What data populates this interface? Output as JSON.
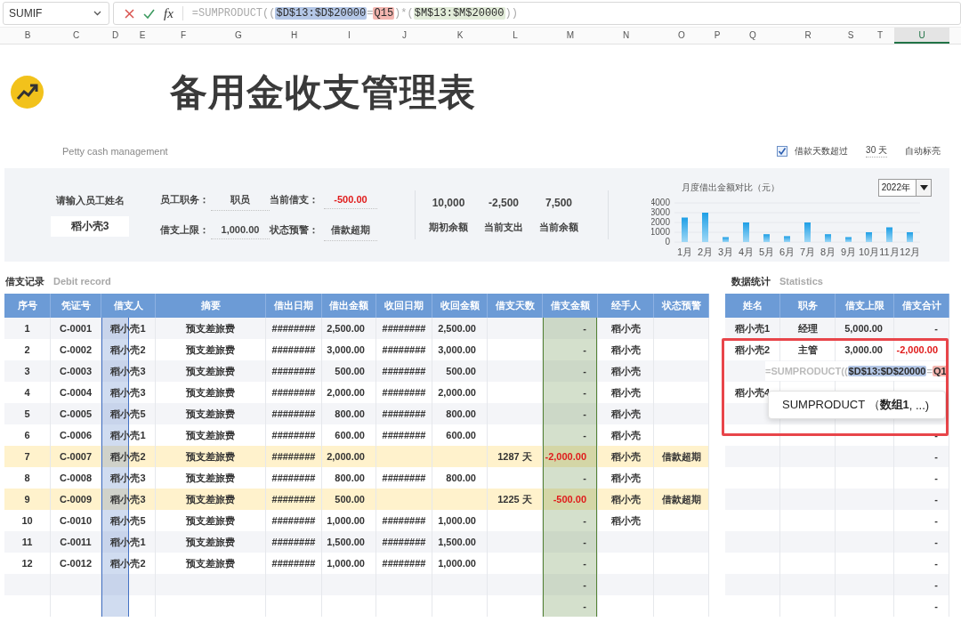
{
  "formula_bar": {
    "name_box": "SUMIF",
    "function_label": "fx",
    "formula": [
      {
        "text": "=SUMPRODUCT(("
      },
      {
        "text": "$D$13:$D$20000",
        "color": "#b4c7e7"
      },
      {
        "text": "="
      },
      {
        "text": "Q15",
        "color": "#f4b6b0"
      },
      {
        "text": ")*("
      },
      {
        "text": "$M$13:$M$20000",
        "color": "#e2ecd9"
      },
      {
        "text": "))"
      }
    ]
  },
  "column_headers": [
    {
      "label": "B",
      "selected": false
    },
    {
      "label": "C",
      "selected": false
    },
    {
      "label": "D",
      "selected": false
    },
    {
      "label": "E",
      "selected": false
    },
    {
      "label": "F",
      "selected": false
    },
    {
      "label": "G",
      "selected": false
    },
    {
      "label": "H",
      "selected": false
    },
    {
      "label": "I",
      "selected": false
    },
    {
      "label": "J",
      "selected": false
    },
    {
      "label": "K",
      "selected": false
    },
    {
      "label": "L",
      "selected": false
    },
    {
      "label": "M",
      "selected": false
    },
    {
      "label": "N",
      "selected": false
    },
    {
      "label": "O",
      "selected": false
    },
    {
      "label": "P",
      "selected": false
    },
    {
      "label": "Q",
      "selected": false
    },
    {
      "label": "R",
      "selected": false
    },
    {
      "label": "S",
      "selected": false
    },
    {
      "label": "T",
      "selected": false
    },
    {
      "label": "U",
      "selected": true
    }
  ],
  "title": "备用金收支管理表",
  "subtitle": "Petty cash management",
  "highlight_option": {
    "checked": true,
    "label": "借款天数超过",
    "days": "30 天",
    "action": "自动标亮"
  },
  "lookup_panel": {
    "prompt": "请输入员工姓名",
    "employee_name": "稻小壳3",
    "fields": [
      {
        "label": "员工职务：",
        "value": "职员",
        "alert": false
      },
      {
        "label": "当前借支：",
        "value": "-500.00",
        "alert": true
      },
      {
        "label": "借支上限：",
        "value": "1,000.00",
        "alert": false
      },
      {
        "label": "状态预警：",
        "value": "借款超期",
        "alert": false
      }
    ],
    "totals": [
      {
        "value": "10,000",
        "label": "期初余额"
      },
      {
        "value": "-2,500",
        "label": "当前支出"
      },
      {
        "value": "7,500",
        "label": "当前余额"
      }
    ]
  },
  "monthly_chart": {
    "year": "2022年",
    "chart_data": {
      "type": "bar",
      "title": "月度借出金额对比（元）",
      "categories": [
        "1月",
        "2月",
        "3月",
        "4月",
        "5月",
        "6月",
        "7月",
        "8月",
        "9月",
        "10月",
        "11月",
        "12月"
      ],
      "series": [
        {
          "color": "#1e9fe6",
          "values": [
            2500,
            3000,
            500,
            2000,
            800,
            600,
            2000,
            800,
            500,
            1000,
            1500,
            1000
          ]
        }
      ],
      "ylim": [
        0,
        4000
      ],
      "grid": true,
      "yticks": [
        0,
        1000,
        2000,
        3000,
        4000
      ]
    }
  },
  "debit_record": {
    "title": "借支记录",
    "subtitle": "Debit record",
    "columns": [
      {
        "label": "序号",
        "kind": "text"
      },
      {
        "label": "凭证号",
        "kind": "text"
      },
      {
        "label": "借支人",
        "kind": "text",
        "color": "#4472c4",
        "half_width": true
      },
      {
        "label": "摘要",
        "kind": "text"
      },
      {
        "label": "借出日期",
        "kind": "text"
      },
      {
        "label": "借出金额",
        "kind": "number"
      },
      {
        "label": "收回日期",
        "kind": "text"
      },
      {
        "label": "收回金额",
        "kind": "number"
      },
      {
        "label": "借支天数",
        "kind": "text"
      },
      {
        "label": "借支金额",
        "kind": "balance",
        "color": "#548235",
        "half_width": false
      },
      {
        "label": "经手人",
        "kind": "text"
      },
      {
        "label": "状态预警",
        "kind": "text"
      }
    ],
    "rows": [
      {
        "overdue": false,
        "cells": [
          "1",
          "C-0001",
          "稻小壳1",
          "预支差旅费",
          "########",
          "2,500.00",
          "########",
          "2,500.00",
          null,
          "-",
          "稻小壳",
          null
        ]
      },
      {
        "overdue": false,
        "cells": [
          "2",
          "C-0002",
          "稻小壳2",
          "预支差旅费",
          "########",
          "3,000.00",
          "########",
          "3,000.00",
          null,
          "-",
          "稻小壳",
          null
        ]
      },
      {
        "overdue": false,
        "cells": [
          "3",
          "C-0003",
          "稻小壳3",
          "预支差旅费",
          "########",
          "500.00",
          "########",
          "500.00",
          null,
          "-",
          "稻小壳",
          null
        ]
      },
      {
        "overdue": false,
        "cells": [
          "4",
          "C-0004",
          "稻小壳3",
          "预支差旅费",
          "########",
          "2,000.00",
          "########",
          "2,000.00",
          null,
          "-",
          "稻小壳",
          null
        ]
      },
      {
        "overdue": false,
        "cells": [
          "5",
          "C-0005",
          "稻小壳5",
          "预支差旅费",
          "########",
          "800.00",
          "########",
          "800.00",
          null,
          "-",
          "稻小壳",
          null
        ]
      },
      {
        "overdue": false,
        "cells": [
          "6",
          "C-0006",
          "稻小壳1",
          "预支差旅费",
          "########",
          "600.00",
          "########",
          "600.00",
          null,
          "-",
          "稻小壳",
          null
        ]
      },
      {
        "overdue": true,
        "cells": [
          "7",
          "C-0007",
          "稻小壳2",
          "预支差旅费",
          "########",
          "2,000.00",
          null,
          null,
          "1287 天",
          "-2,000.00",
          "稻小壳",
          "借款超期"
        ]
      },
      {
        "overdue": false,
        "cells": [
          "8",
          "C-0008",
          "稻小壳3",
          "预支差旅费",
          "########",
          "800.00",
          "########",
          "800.00",
          null,
          "-",
          "稻小壳",
          null
        ]
      },
      {
        "overdue": true,
        "cells": [
          "9",
          "C-0009",
          "稻小壳3",
          "预支差旅费",
          "########",
          "500.00",
          null,
          null,
          "1225 天",
          "-500.00",
          "稻小壳",
          "借款超期"
        ]
      },
      {
        "overdue": false,
        "cells": [
          "10",
          "C-0010",
          "稻小壳5",
          "预支差旅费",
          "########",
          "1,000.00",
          "########",
          "1,000.00",
          null,
          "-",
          "稻小壳",
          null
        ]
      },
      {
        "overdue": false,
        "cells": [
          "11",
          "C-0011",
          "稻小壳1",
          "预支差旅费",
          "########",
          "1,500.00",
          "########",
          "1,500.00",
          null,
          "-",
          null,
          null
        ]
      },
      {
        "overdue": false,
        "cells": [
          "12",
          "C-0012",
          "稻小壳2",
          "预支差旅费",
          "########",
          "1,000.00",
          "########",
          "1,000.00",
          null,
          "-",
          null,
          null
        ]
      },
      {
        "overdue": false,
        "cells": [
          null,
          null,
          null,
          null,
          null,
          null,
          null,
          null,
          null,
          "-",
          null,
          null
        ]
      },
      {
        "overdue": false,
        "cells": [
          null,
          null,
          null,
          null,
          null,
          null,
          null,
          null,
          null,
          "-",
          null,
          null
        ]
      }
    ]
  },
  "statistics": {
    "title": "数据统计",
    "subtitle": "Statistics",
    "columns": [
      {
        "label": "姓名",
        "kind": "text"
      },
      {
        "label": "职务",
        "kind": "text"
      },
      {
        "label": "借支上限",
        "kind": "number"
      },
      {
        "label": "借支合计",
        "kind": "balance"
      }
    ],
    "rows": [
      {
        "overdue": false,
        "cells": [
          "稻小壳1",
          "经理",
          "5,000.00",
          "-"
        ]
      },
      {
        "overdue": true,
        "cells": [
          "稻小壳2",
          "主管",
          "3,000.00",
          "-2,000.00"
        ]
      },
      {
        "cells": [
          null,
          null,
          null,
          null
        ]
      },
      {
        "cells": [
          "稻小壳4",
          null,
          null,
          null
        ]
      },
      {
        "cells": [
          null,
          null,
          null,
          null
        ]
      },
      {
        "overdue": false,
        "cells": [
          null,
          null,
          null,
          "-"
        ]
      },
      {
        "overdue": false,
        "cells": [
          null,
          null,
          null,
          "-"
        ]
      },
      {
        "overdue": false,
        "cells": [
          null,
          null,
          null,
          "-"
        ]
      },
      {
        "overdue": false,
        "cells": [
          null,
          null,
          null,
          "-"
        ]
      },
      {
        "overdue": false,
        "cells": [
          null,
          null,
          null,
          "-"
        ]
      },
      {
        "overdue": false,
        "cells": [
          null,
          null,
          null,
          "-"
        ]
      },
      {
        "overdue": false,
        "cells": [
          null,
          null,
          null,
          "-"
        ]
      },
      {
        "overdue": false,
        "cells": [
          null,
          null,
          null,
          "-"
        ]
      },
      {
        "overdue": false,
        "cells": [
          null,
          null,
          null,
          "-"
        ]
      }
    ],
    "cell_editor": [
      {
        "text": "=SUMPRODUCT(("
      },
      {
        "text": "$D$13:$D$20000",
        "color": "#b4c7e7"
      },
      {
        "text": "="
      },
      {
        "text": "Q1",
        "color": "#f4b6b0"
      }
    ],
    "tooltip": "SUMPRODUCT （**数组1**, ...)"
  }
}
